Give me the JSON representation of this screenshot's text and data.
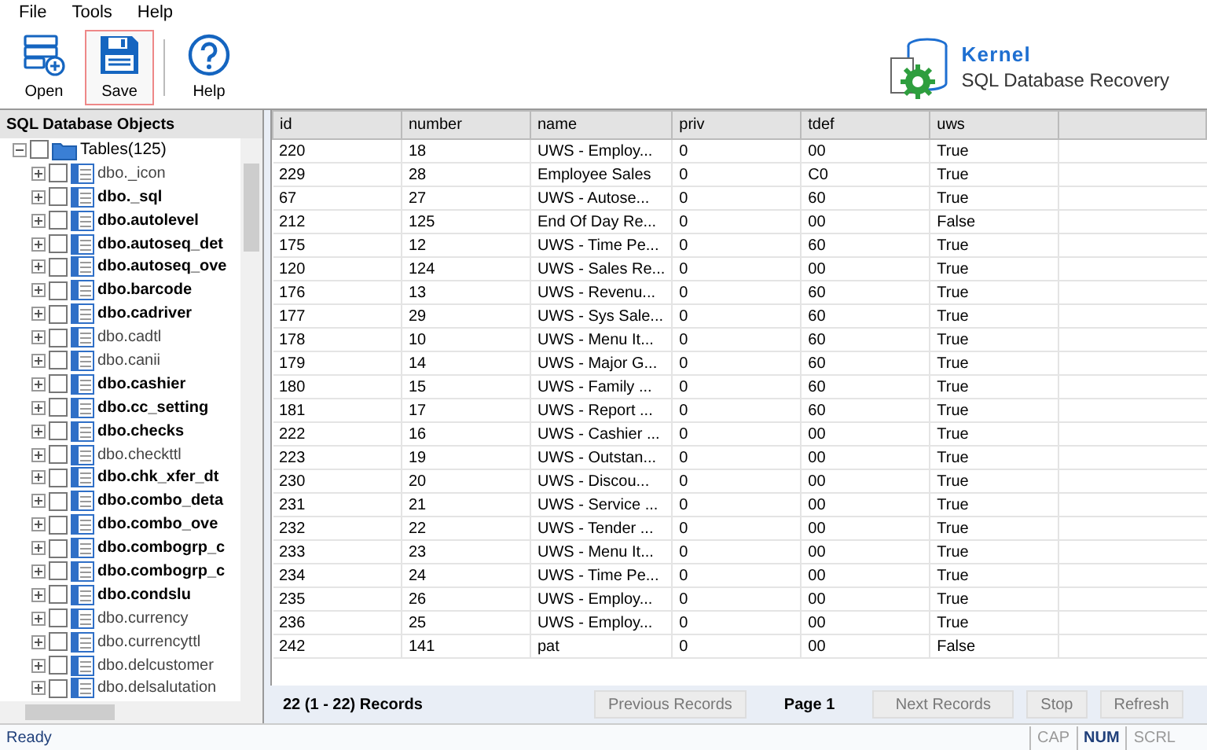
{
  "menu": [
    "File",
    "Tools",
    "Help"
  ],
  "toolbar": [
    {
      "kind": "open",
      "label": "Open",
      "selected": false
    },
    {
      "kind": "save",
      "label": "Save",
      "selected": true
    },
    {
      "kind": "help",
      "label": "Help",
      "selected": false
    }
  ],
  "brand": {
    "name": "Kernel",
    "product": "SQL Database Recovery"
  },
  "tree": {
    "title": "SQL Database Objects",
    "root": {
      "label": "Tables(125)",
      "checked": false,
      "expanded": true,
      "children": [
        {
          "label": "dbo._icon",
          "bold": false,
          "checked": false
        },
        {
          "label": "dbo._sql",
          "bold": true,
          "checked": false
        },
        {
          "label": "dbo.autolevel",
          "bold": true,
          "checked": false
        },
        {
          "label": "dbo.autoseq_det",
          "bold": true,
          "checked": false
        },
        {
          "label": "dbo.autoseq_ove",
          "bold": true,
          "checked": false
        },
        {
          "label": "dbo.barcode",
          "bold": true,
          "checked": false
        },
        {
          "label": "dbo.cadriver",
          "bold": true,
          "checked": false
        },
        {
          "label": "dbo.cadtl",
          "bold": false,
          "checked": false
        },
        {
          "label": "dbo.canii",
          "bold": false,
          "checked": false
        },
        {
          "label": "dbo.cashier",
          "bold": true,
          "checked": false
        },
        {
          "label": "dbo.cc_setting",
          "bold": true,
          "checked": false
        },
        {
          "label": "dbo.checks",
          "bold": true,
          "checked": false
        },
        {
          "label": "dbo.checkttl",
          "bold": false,
          "checked": false
        },
        {
          "label": "dbo.chk_xfer_dt",
          "bold": true,
          "checked": false
        },
        {
          "label": "dbo.combo_deta",
          "bold": true,
          "checked": false
        },
        {
          "label": "dbo.combo_ove",
          "bold": true,
          "checked": false
        },
        {
          "label": "dbo.combogrp_c",
          "bold": true,
          "checked": false
        },
        {
          "label": "dbo.combogrp_c",
          "bold": true,
          "checked": false
        },
        {
          "label": "dbo.condslu",
          "bold": true,
          "checked": false
        },
        {
          "label": "dbo.currency",
          "bold": false,
          "checked": false
        },
        {
          "label": "dbo.currencyttl",
          "bold": false,
          "checked": false
        },
        {
          "label": "dbo.delcustomer",
          "bold": false,
          "checked": false
        },
        {
          "label": "dbo.delsalutation",
          "bold": false,
          "checked": false
        }
      ]
    }
  },
  "table": {
    "columns": [
      "id",
      "number",
      "name",
      "priv",
      "tdef",
      "uws"
    ],
    "rows": [
      [
        "220",
        "18",
        "UWS - Employ...",
        "0",
        "00",
        "True"
      ],
      [
        "229",
        "28",
        "Employee Sales",
        "0",
        "C0",
        "True"
      ],
      [
        "67",
        "27",
        "UWS - Autose...",
        "0",
        "60",
        "True"
      ],
      [
        "212",
        "125",
        "End Of Day Re...",
        "0",
        "00",
        "False"
      ],
      [
        "175",
        "12",
        "UWS - Time Pe...",
        "0",
        "60",
        "True"
      ],
      [
        "120",
        "124",
        "UWS - Sales Re...",
        "0",
        "00",
        "True"
      ],
      [
        "176",
        "13",
        "UWS - Revenu...",
        "0",
        "60",
        "True"
      ],
      [
        "177",
        "29",
        "UWS - Sys Sale...",
        "0",
        "60",
        "True"
      ],
      [
        "178",
        "10",
        "UWS - Menu It...",
        "0",
        "60",
        "True"
      ],
      [
        "179",
        "14",
        "UWS - Major G...",
        "0",
        "60",
        "True"
      ],
      [
        "180",
        "15",
        "UWS - Family ...",
        "0",
        "60",
        "True"
      ],
      [
        "181",
        "17",
        "UWS - Report ...",
        "0",
        "60",
        "True"
      ],
      [
        "222",
        "16",
        "UWS - Cashier ...",
        "0",
        "00",
        "True"
      ],
      [
        "223",
        "19",
        "UWS - Outstan...",
        "0",
        "00",
        "True"
      ],
      [
        "230",
        "20",
        "UWS - Discou...",
        "0",
        "00",
        "True"
      ],
      [
        "231",
        "21",
        "UWS - Service ...",
        "0",
        "00",
        "True"
      ],
      [
        "232",
        "22",
        "UWS - Tender ...",
        "0",
        "00",
        "True"
      ],
      [
        "233",
        "23",
        "UWS - Menu It...",
        "0",
        "00",
        "True"
      ],
      [
        "234",
        "24",
        "UWS - Time Pe...",
        "0",
        "00",
        "True"
      ],
      [
        "235",
        "26",
        "UWS - Employ...",
        "0",
        "00",
        "True"
      ],
      [
        "236",
        "25",
        "UWS - Employ...",
        "0",
        "00",
        "True"
      ],
      [
        "242",
        "141",
        "pat",
        "0",
        "00",
        "False"
      ]
    ]
  },
  "footer": {
    "records": "22 (1 - 22) Records",
    "page": "Page 1",
    "buttons": [
      {
        "label": "Previous Records",
        "disabled": true
      },
      {
        "label": "Next Records",
        "disabled": true
      },
      {
        "label": "Stop",
        "disabled": true
      },
      {
        "label": "Refresh",
        "disabled": true
      }
    ]
  },
  "status_bar": {
    "text": "Ready",
    "indicators": [
      {
        "label": "CAP",
        "on": false
      },
      {
        "label": "NUM",
        "on": true
      },
      {
        "label": "SCRL",
        "on": false
      }
    ]
  }
}
